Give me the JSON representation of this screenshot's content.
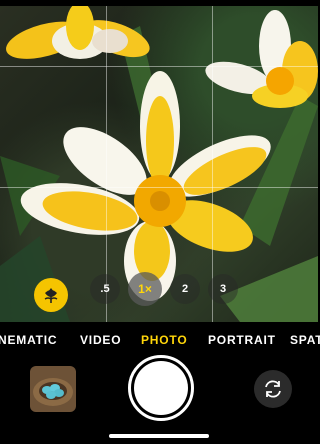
{
  "camera": {
    "zoom_levels": [
      ".5",
      "1×",
      "2",
      "3"
    ],
    "active_zoom": "1×",
    "macro_icon": "flower-macro-icon",
    "modes": [
      "NEMATIC",
      "VIDEO",
      "PHOTO",
      "PORTRAIT",
      "SPAT"
    ],
    "active_mode": "PHOTO",
    "thumbnail_icon": "last-photo-thumbnail",
    "flip_icon": "camera-flip-icon",
    "accent_color": "#ffd60a"
  }
}
